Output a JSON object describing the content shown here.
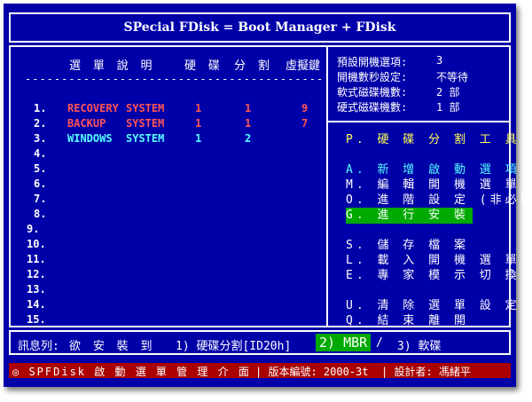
{
  "title": "SPecial FDisk = Boot Manager + FDisk",
  "table": {
    "headers": [
      "選 單 說 明",
      "硬 碟",
      "分 割",
      "虛擬鍵"
    ],
    "dashes": "--------------------------------------------------",
    "rows": [
      {
        "num": "1.",
        "name": "RECOVERY",
        "sys": "SYSTEM",
        "disk": "1",
        "part": "1",
        "key": "9"
      },
      {
        "num": "2.",
        "name": "BACKUP",
        "sys": "SYSTEM",
        "disk": "1",
        "part": "1",
        "key": "7"
      },
      {
        "num": "3.",
        "name": "WINDOWS",
        "sys": "SYSTEM",
        "disk": "1",
        "part": "2",
        "key": ""
      },
      {
        "num": "4."
      },
      {
        "num": "5."
      },
      {
        "num": "6."
      },
      {
        "num": "7."
      },
      {
        "num": "8."
      },
      {
        "num": "9."
      },
      {
        "num": "10."
      },
      {
        "num": "11."
      },
      {
        "num": "12."
      },
      {
        "num": "13."
      },
      {
        "num": "14."
      },
      {
        "num": "15."
      }
    ]
  },
  "info": {
    "default_label": "預設開機選項:",
    "default_value": "3",
    "seconds_label": "開機數秒設定:",
    "seconds_value": "不等待",
    "floppy_label": "軟式磁碟機數:",
    "floppy_value": "2 部",
    "hdd_label": "硬式磁碟機數:",
    "hdd_value": "1 部"
  },
  "menu": {
    "p": {
      "key": "P.",
      "label": "硬 碟 分 割 工 具"
    },
    "a": {
      "key": "A.",
      "label": "新 增 啟 動 選 項"
    },
    "m": {
      "key": "M.",
      "label": "編 輯 開 機 選 單"
    },
    "o": {
      "key": "O.",
      "label": "進 階 設 定 (非必要)"
    },
    "g": {
      "key": "G.",
      "label": "進 行 安 裝"
    },
    "s": {
      "key": "S.",
      "label": "儲 存 檔 案"
    },
    "l": {
      "key": "L.",
      "label": "載 入 開 機 選 單"
    },
    "e": {
      "key": "E.",
      "label": "專 家 模 示 切 換"
    },
    "u": {
      "key": "U.",
      "label": "清 除 選 單 設 定"
    },
    "q": {
      "key": "Q.",
      "label": "結 束 離 開"
    }
  },
  "status": {
    "prompt": "訊息列:",
    "text": "欲 安 裝 到",
    "opt1": "1) 硬碟分割[ID20h]",
    "opt2": "2) MBR",
    "sep": "/",
    "opt3": "3) 軟碟"
  },
  "footer": {
    "app": "◎ SPFDisk 啟 動 選 單 管 理 介 面",
    "version": "| 版本編號: 2000-3t",
    "author": "| 設計者: 馮緒平"
  },
  "colors": {
    "background": "#0000a8",
    "border": "#ffffff",
    "name_red": "#ff5555",
    "name_cyan": "#55ffff",
    "highlight": "#00aa00",
    "menu_yellow": "#ffff55",
    "menu_cyan": "#55ffff",
    "footer_bg": "#aa0000"
  }
}
